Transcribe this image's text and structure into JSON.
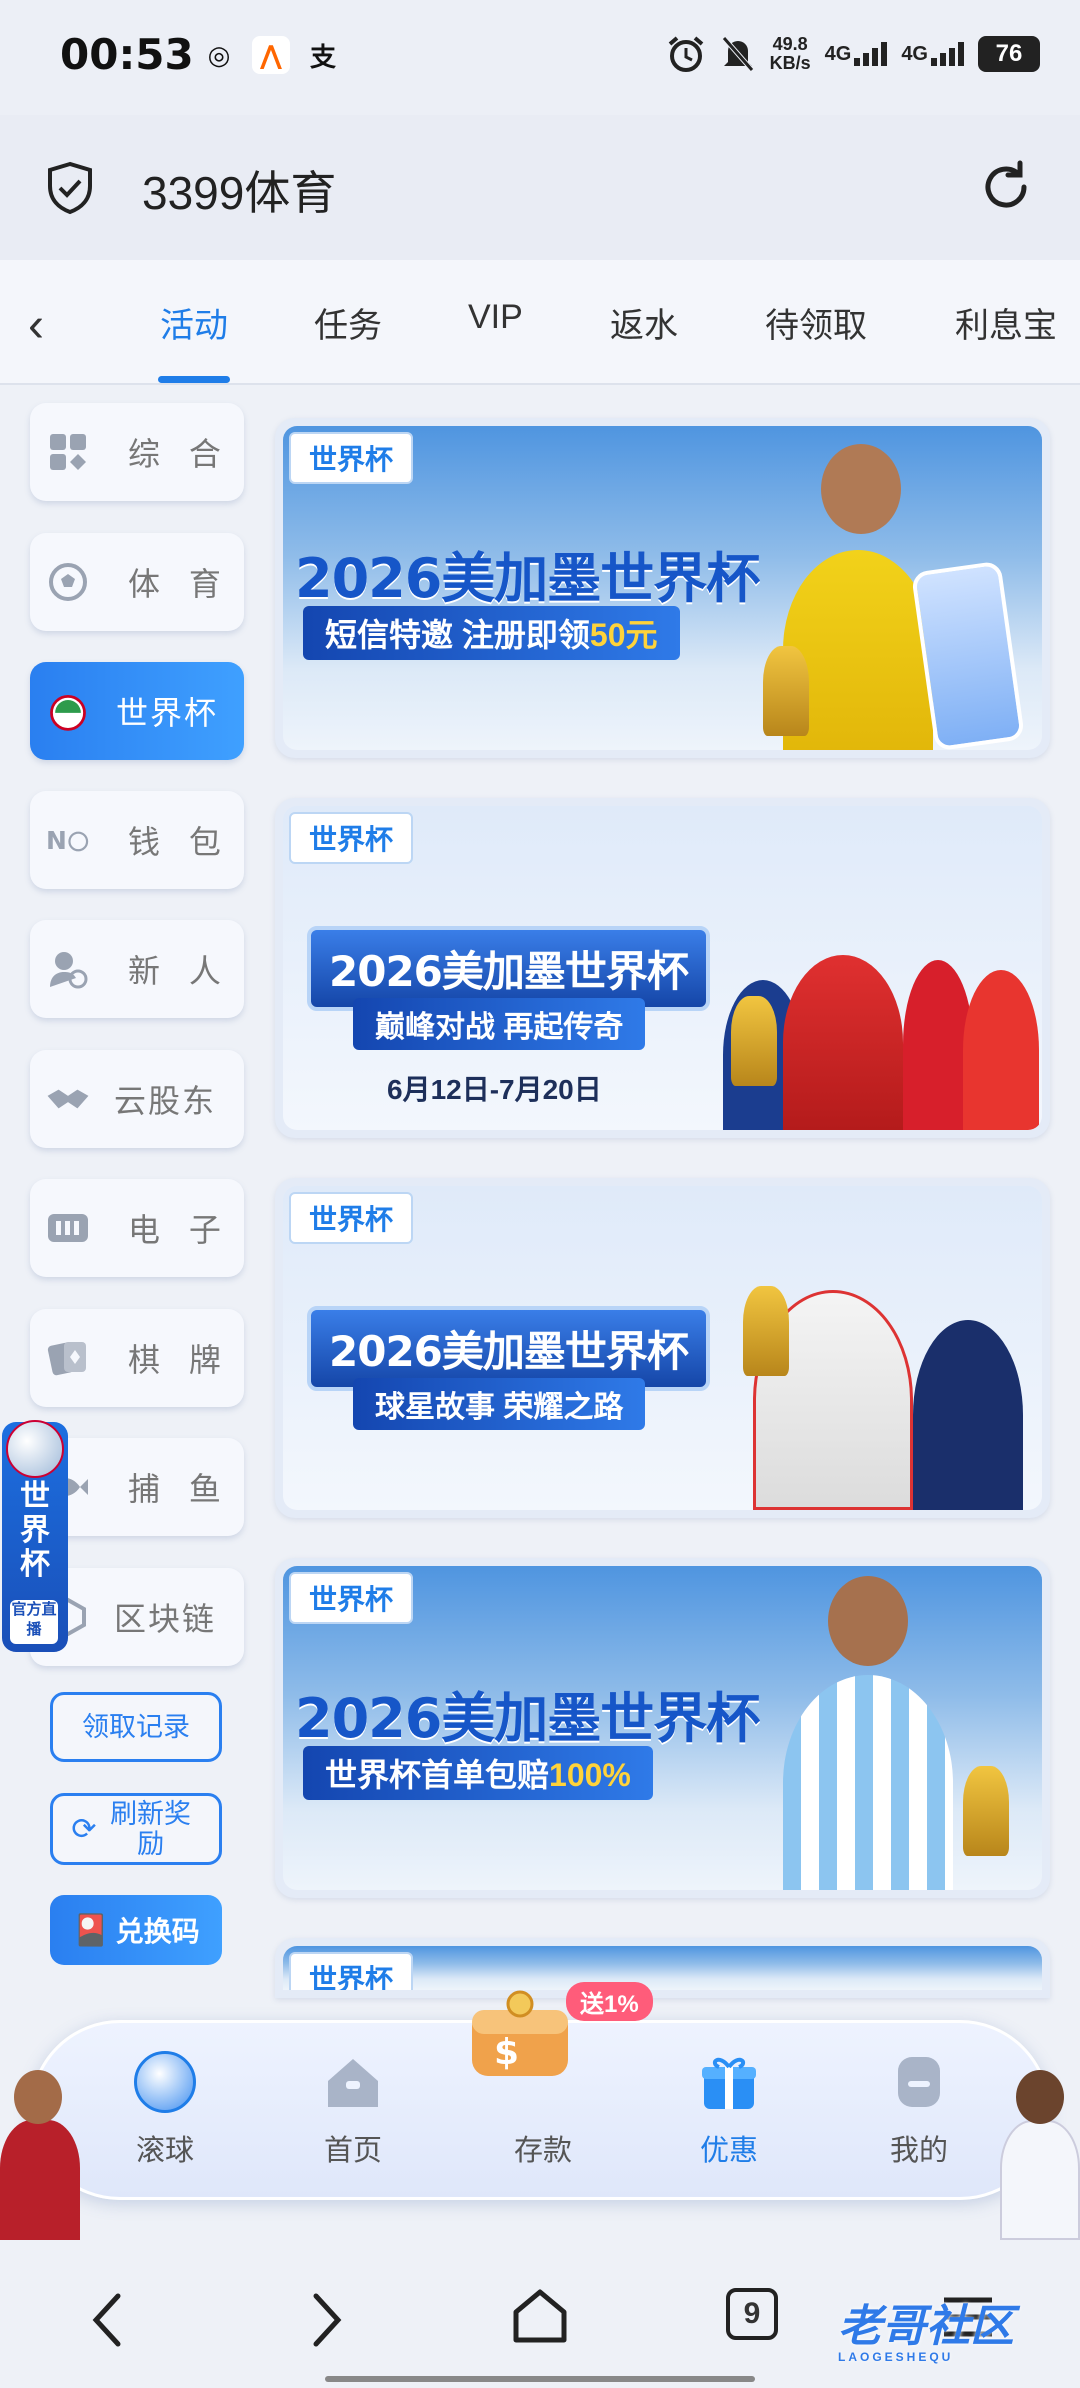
{
  "status_bar": {
    "time": "00:53",
    "net_speed_value": "49.8",
    "net_speed_unit": "KB/s",
    "signal1": "4G",
    "signal2": "4G",
    "battery": "76"
  },
  "header": {
    "title": "3399体育"
  },
  "tabs": [
    {
      "label": "活动",
      "active": true
    },
    {
      "label": "任务"
    },
    {
      "label": "VIP"
    },
    {
      "label": "返水"
    },
    {
      "label": "待领取"
    },
    {
      "label": "利息宝"
    }
  ],
  "categories": [
    {
      "label": "综 合",
      "icon": "grid-icon"
    },
    {
      "label": "体 育",
      "icon": "soccer-ball-icon"
    },
    {
      "label": "世界杯",
      "icon": "world-cup-icon",
      "active": true
    },
    {
      "label": "钱 包",
      "icon": "wallet-coin-icon"
    },
    {
      "label": "新 人",
      "icon": "new-user-icon"
    },
    {
      "label": "云股东",
      "icon": "handshake-icon"
    },
    {
      "label": "电 子",
      "icon": "slot-machine-icon"
    },
    {
      "label": "棋 牌",
      "icon": "playing-cards-icon"
    },
    {
      "label": "捕 鱼",
      "icon": "fish-icon"
    },
    {
      "label": "区块链",
      "icon": "blockchain-icon"
    }
  ],
  "side_buttons": {
    "records": "领取记录",
    "refresh": "刷新奖励",
    "redeem": "兑换码"
  },
  "float_badge": {
    "text": "世界杯",
    "tag": "官方直播"
  },
  "banners": [
    {
      "tag": "世界杯",
      "title": "2026美加墨世界杯",
      "subtitle_pre": "短信特邀 注册即领",
      "subtitle_hl": "50元"
    },
    {
      "tag": "世界杯",
      "title": "2026美加墨世界杯",
      "subtitle_pre": "巅峰对战 再起传奇",
      "date": "6月12日-7月20日"
    },
    {
      "tag": "世界杯",
      "title": "2026美加墨世界杯",
      "subtitle_pre": "球星故事 荣耀之路"
    },
    {
      "tag": "世界杯",
      "title": "2026美加墨世界杯",
      "subtitle_pre": "世界杯首单包赔",
      "subtitle_hl": "100%"
    },
    {
      "tag": "世界杯"
    }
  ],
  "bottom_nav": [
    {
      "label": "滚球",
      "icon": "live-ball-icon"
    },
    {
      "label": "首页",
      "icon": "home-icon"
    },
    {
      "label": "存款",
      "icon": "wallet-deposit-icon"
    },
    {
      "label": "优惠",
      "icon": "gift-icon",
      "active": true
    },
    {
      "label": "我的",
      "icon": "profile-icon"
    }
  ],
  "deposit_badge": "送1%",
  "system_nav": {
    "tab_count": "9",
    "watermark": "老哥社区",
    "watermark_sub": "LAOGESHEQU"
  },
  "colors": {
    "accent": "#1f7de8",
    "badge": "#ff5c7a",
    "background": "#eef1f7"
  }
}
